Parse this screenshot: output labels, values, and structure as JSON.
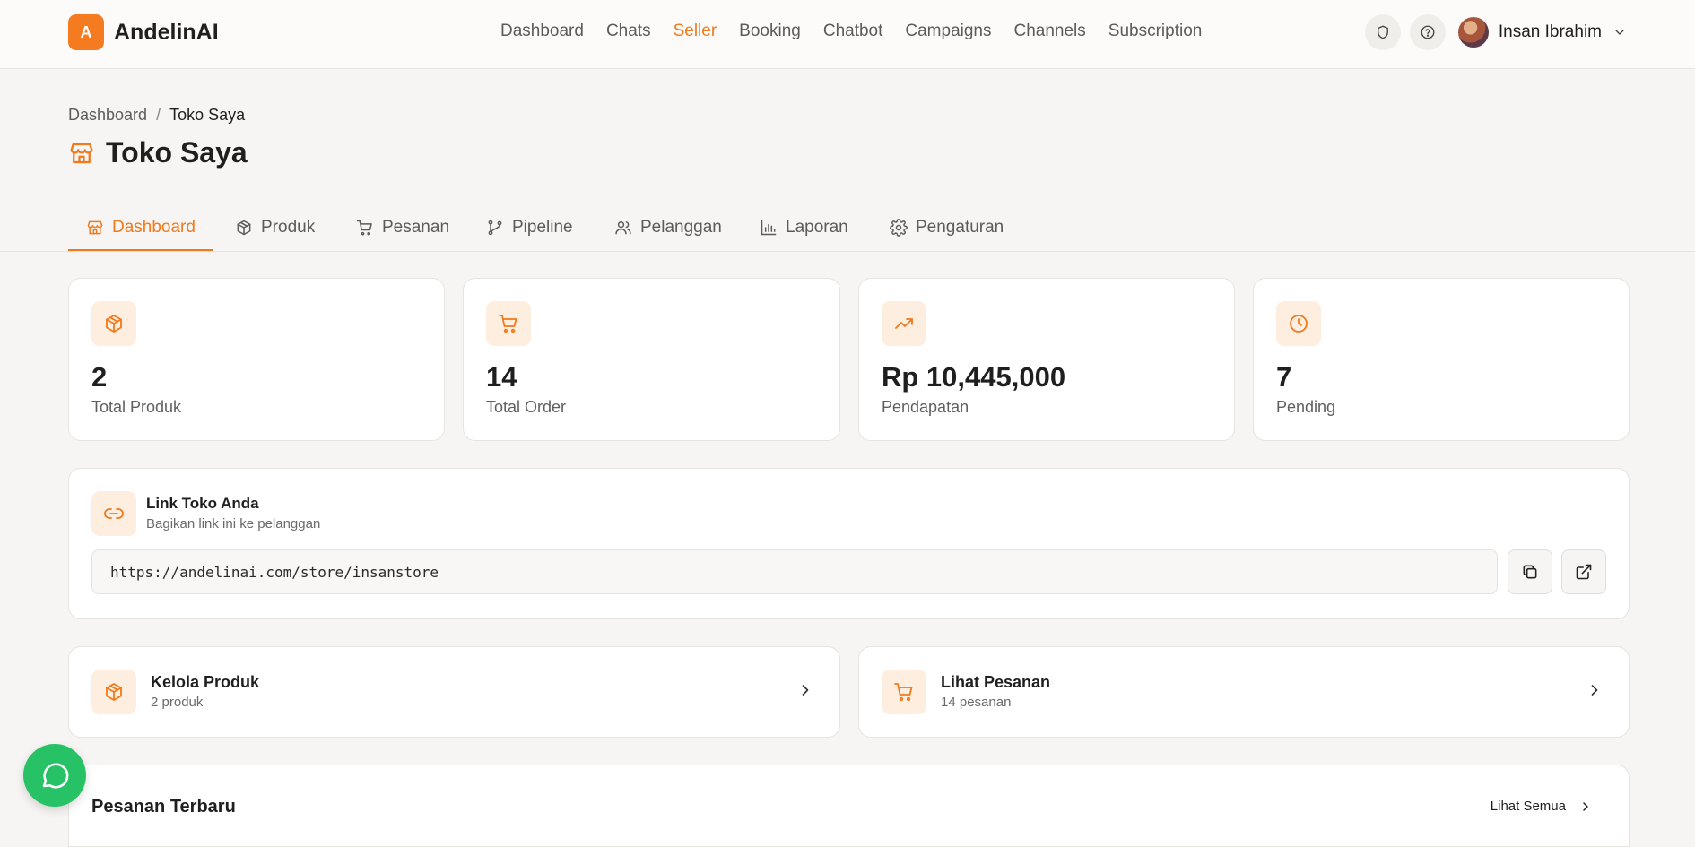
{
  "app": {
    "logo_letter": "A",
    "name": "AndelinAI"
  },
  "nav": [
    {
      "label": "Dashboard"
    },
    {
      "label": "Chats"
    },
    {
      "label": "Seller",
      "active": true
    },
    {
      "label": "Booking"
    },
    {
      "label": "Chatbot"
    },
    {
      "label": "Campaigns"
    },
    {
      "label": "Channels"
    },
    {
      "label": "Subscription"
    }
  ],
  "user": {
    "name": "Insan Ibrahim"
  },
  "breadcrumb": {
    "parent": "Dashboard",
    "separator": "/",
    "current": "Toko Saya"
  },
  "page": {
    "title": "Toko Saya"
  },
  "tabs": [
    {
      "label": "Dashboard",
      "icon": "store-icon",
      "active": true
    },
    {
      "label": "Produk",
      "icon": "package-icon"
    },
    {
      "label": "Pesanan",
      "icon": "cart-icon"
    },
    {
      "label": "Pipeline",
      "icon": "git-branch-icon"
    },
    {
      "label": "Pelanggan",
      "icon": "users-icon"
    },
    {
      "label": "Laporan",
      "icon": "bar-chart-icon"
    },
    {
      "label": "Pengaturan",
      "icon": "gear-icon"
    }
  ],
  "stats": [
    {
      "value": "2",
      "label": "Total Produk",
      "icon": "package-icon"
    },
    {
      "value": "14",
      "label": "Total Order",
      "icon": "cart-icon"
    },
    {
      "value": "Rp 10,445,000",
      "label": "Pendapatan",
      "icon": "trending-up-icon"
    },
    {
      "value": "7",
      "label": "Pending",
      "icon": "clock-icon"
    }
  ],
  "store_link": {
    "title": "Link Toko Anda",
    "subtitle": "Bagikan link ini ke pelanggan",
    "url": "https://andelinai.com/store/insanstore"
  },
  "quick_actions": [
    {
      "title": "Kelola Produk",
      "subtitle": "2 produk",
      "icon": "package-icon"
    },
    {
      "title": "Lihat Pesanan",
      "subtitle": "14 pesanan",
      "icon": "cart-icon"
    }
  ],
  "recent_orders": {
    "title": "Pesanan Terbaru",
    "view_all": "Lihat Semua"
  },
  "colors": {
    "accent": "#f07a1c",
    "icon_tile": "#fdeee0",
    "whatsapp": "#27c265",
    "background": "#f6f5f3"
  }
}
